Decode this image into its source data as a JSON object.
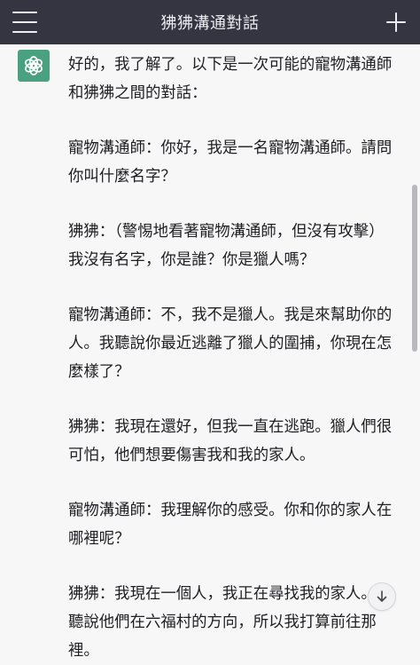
{
  "header": {
    "title": "狒狒溝通對話",
    "menu_icon": "hamburger-menu-icon",
    "new_chat_icon": "plus-icon"
  },
  "assistant": {
    "avatar_icon": "openai-logo-icon",
    "avatar_color": "#4aa181"
  },
  "message": {
    "paragraphs": [
      "好的，我了解了。以下是一次可能的寵物溝通師和狒狒之間的對話：",
      "寵物溝通師：你好，我是一名寵物溝通師。請問你叫什麼名字？",
      "狒狒：（警惕地看著寵物溝通師，但沒有攻擊）我沒有名字，你是誰？你是獵人嗎？",
      "寵物溝通師：不，我不是獵人。我是來幫助你的人。我聽說你最近逃離了獵人的圍捕，你現在怎麼樣了？",
      "狒狒：我現在還好，但我一直在逃跑。獵人們很可怕，他們想要傷害我和我的家人。",
      "寵物溝通師：我理解你的感受。你和你的家人在哪裡呢？",
      "狒狒：我現在一個人，我正在尋找我的家人。我聽說他們在六福村的方向，所以我打算前往那裡。"
    ]
  },
  "scroll_down_icon": "arrow-down-icon"
}
